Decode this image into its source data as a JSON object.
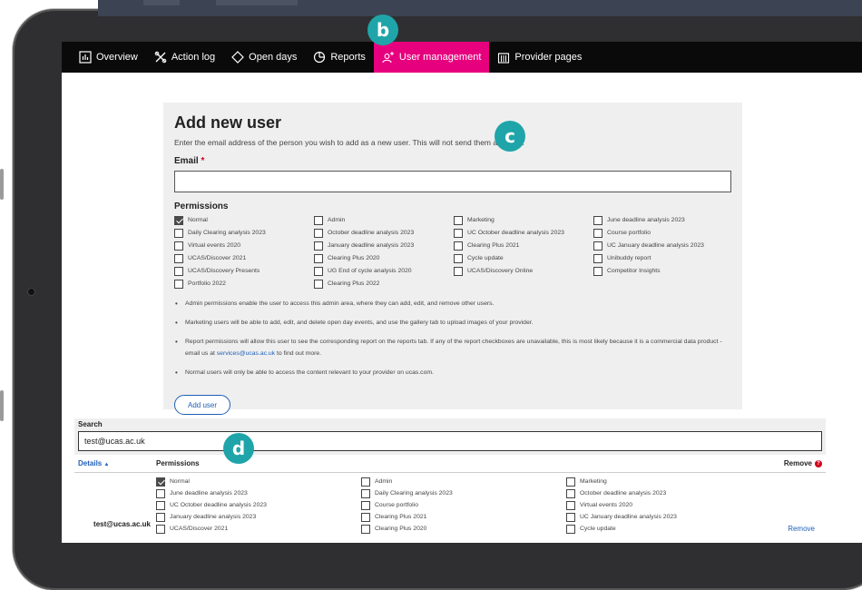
{
  "nav": {
    "items": [
      {
        "label": "Overview",
        "icon": "bar-chart-icon",
        "active": false
      },
      {
        "label": "Action log",
        "icon": "tools-icon",
        "active": false
      },
      {
        "label": "Open days",
        "icon": "diamond-icon",
        "active": false
      },
      {
        "label": "Reports",
        "icon": "pie-chart-icon",
        "active": false
      },
      {
        "label": "User management",
        "icon": "user-add-icon",
        "active": true
      },
      {
        "label": "Provider pages",
        "icon": "building-icon",
        "active": false
      }
    ]
  },
  "callouts": {
    "b": "b",
    "c": "c",
    "d": "d"
  },
  "form": {
    "title": "Add new user",
    "intro": "Enter the email address of the person you wish to add as a new user. This will not send them an email.",
    "email_label": "Email",
    "required_marker": "*",
    "email_value": "",
    "permissions_title": "Permissions",
    "permissions": [
      {
        "label": "Normal",
        "checked": true
      },
      {
        "label": "Admin",
        "checked": false
      },
      {
        "label": "Marketing",
        "checked": false
      },
      {
        "label": "June deadline analysis 2023",
        "checked": false
      },
      {
        "label": "Daily Clearing analysis 2023",
        "checked": false
      },
      {
        "label": "October deadline analysis 2023",
        "checked": false
      },
      {
        "label": "UC October deadline analysis 2023",
        "checked": false
      },
      {
        "label": "Course portfolio",
        "checked": false
      },
      {
        "label": "Virtual events 2020",
        "checked": false
      },
      {
        "label": "January deadline analysis 2023",
        "checked": false
      },
      {
        "label": "Clearing Plus 2021",
        "checked": false
      },
      {
        "label": "UC January deadline analysis 2023",
        "checked": false
      },
      {
        "label": "UCAS/Discover 2021",
        "checked": false
      },
      {
        "label": "Clearing Plus 2020",
        "checked": false
      },
      {
        "label": "Cycle update",
        "checked": false
      },
      {
        "label": "Unibuddy report",
        "checked": false
      },
      {
        "label": "UCAS/Discovery Presents",
        "checked": false
      },
      {
        "label": "UG End of cycle analysis 2020",
        "checked": false
      },
      {
        "label": "UCAS/Discovery Online",
        "checked": false
      },
      {
        "label": "Competitor Insights",
        "checked": false
      },
      {
        "label": "Portfolio 2022",
        "checked": false
      },
      {
        "label": "Clearing Plus 2022",
        "checked": false
      }
    ],
    "notes": {
      "admin": "Admin permissions enable the user to access this admin area, where they can add, edit, and remove other users.",
      "marketing": "Marketing users will be able to add, edit, and delete open day events, and use the gallery tab to upload images of your provider.",
      "report_before": "Report permissions will allow this user to see the corresponding report on the reports tab. If any of the report checkboxes are unavailable, this is most likely because it is a commercial data product - email us at ",
      "report_link": "services@ucas.ac.uk",
      "report_after": " to find out more.",
      "normal": "Normal users will only be able to access the content relevant to your provider on ucas.com."
    },
    "add_button": "Add user"
  },
  "search": {
    "label": "Search",
    "value": "test@ucas.ac.uk",
    "header_details": "Details",
    "header_sort": "▲",
    "header_permissions": "Permissions",
    "header_remove": "Remove",
    "help_glyph": "?"
  },
  "user": {
    "email": "test@ucas.ac.uk",
    "remove_label": "Remove",
    "permissions": [
      {
        "label": "Normal",
        "checked": true
      },
      {
        "label": "Admin",
        "checked": false
      },
      {
        "label": "Marketing",
        "checked": false
      },
      {
        "label": "June deadline analysis 2023",
        "checked": false
      },
      {
        "label": "Daily Clearing analysis 2023",
        "checked": false
      },
      {
        "label": "October deadline analysis 2023",
        "checked": false
      },
      {
        "label": "UC October deadline analysis 2023",
        "checked": false
      },
      {
        "label": "Course portfolio",
        "checked": false
      },
      {
        "label": "Virtual events 2020",
        "checked": false
      },
      {
        "label": "January deadline analysis 2023",
        "checked": false
      },
      {
        "label": "Clearing Plus 2021",
        "checked": false
      },
      {
        "label": "UC January deadline analysis 2023",
        "checked": false
      },
      {
        "label": "UCAS/Discover 2021",
        "checked": false
      },
      {
        "label": "Clearing Plus 2020",
        "checked": false
      },
      {
        "label": "Cycle update",
        "checked": false
      }
    ]
  },
  "colors": {
    "accent": "#e6007e",
    "callout": "#1fa5a9",
    "link": "#1f5fb8",
    "nav_bg": "#0a0a0a"
  }
}
